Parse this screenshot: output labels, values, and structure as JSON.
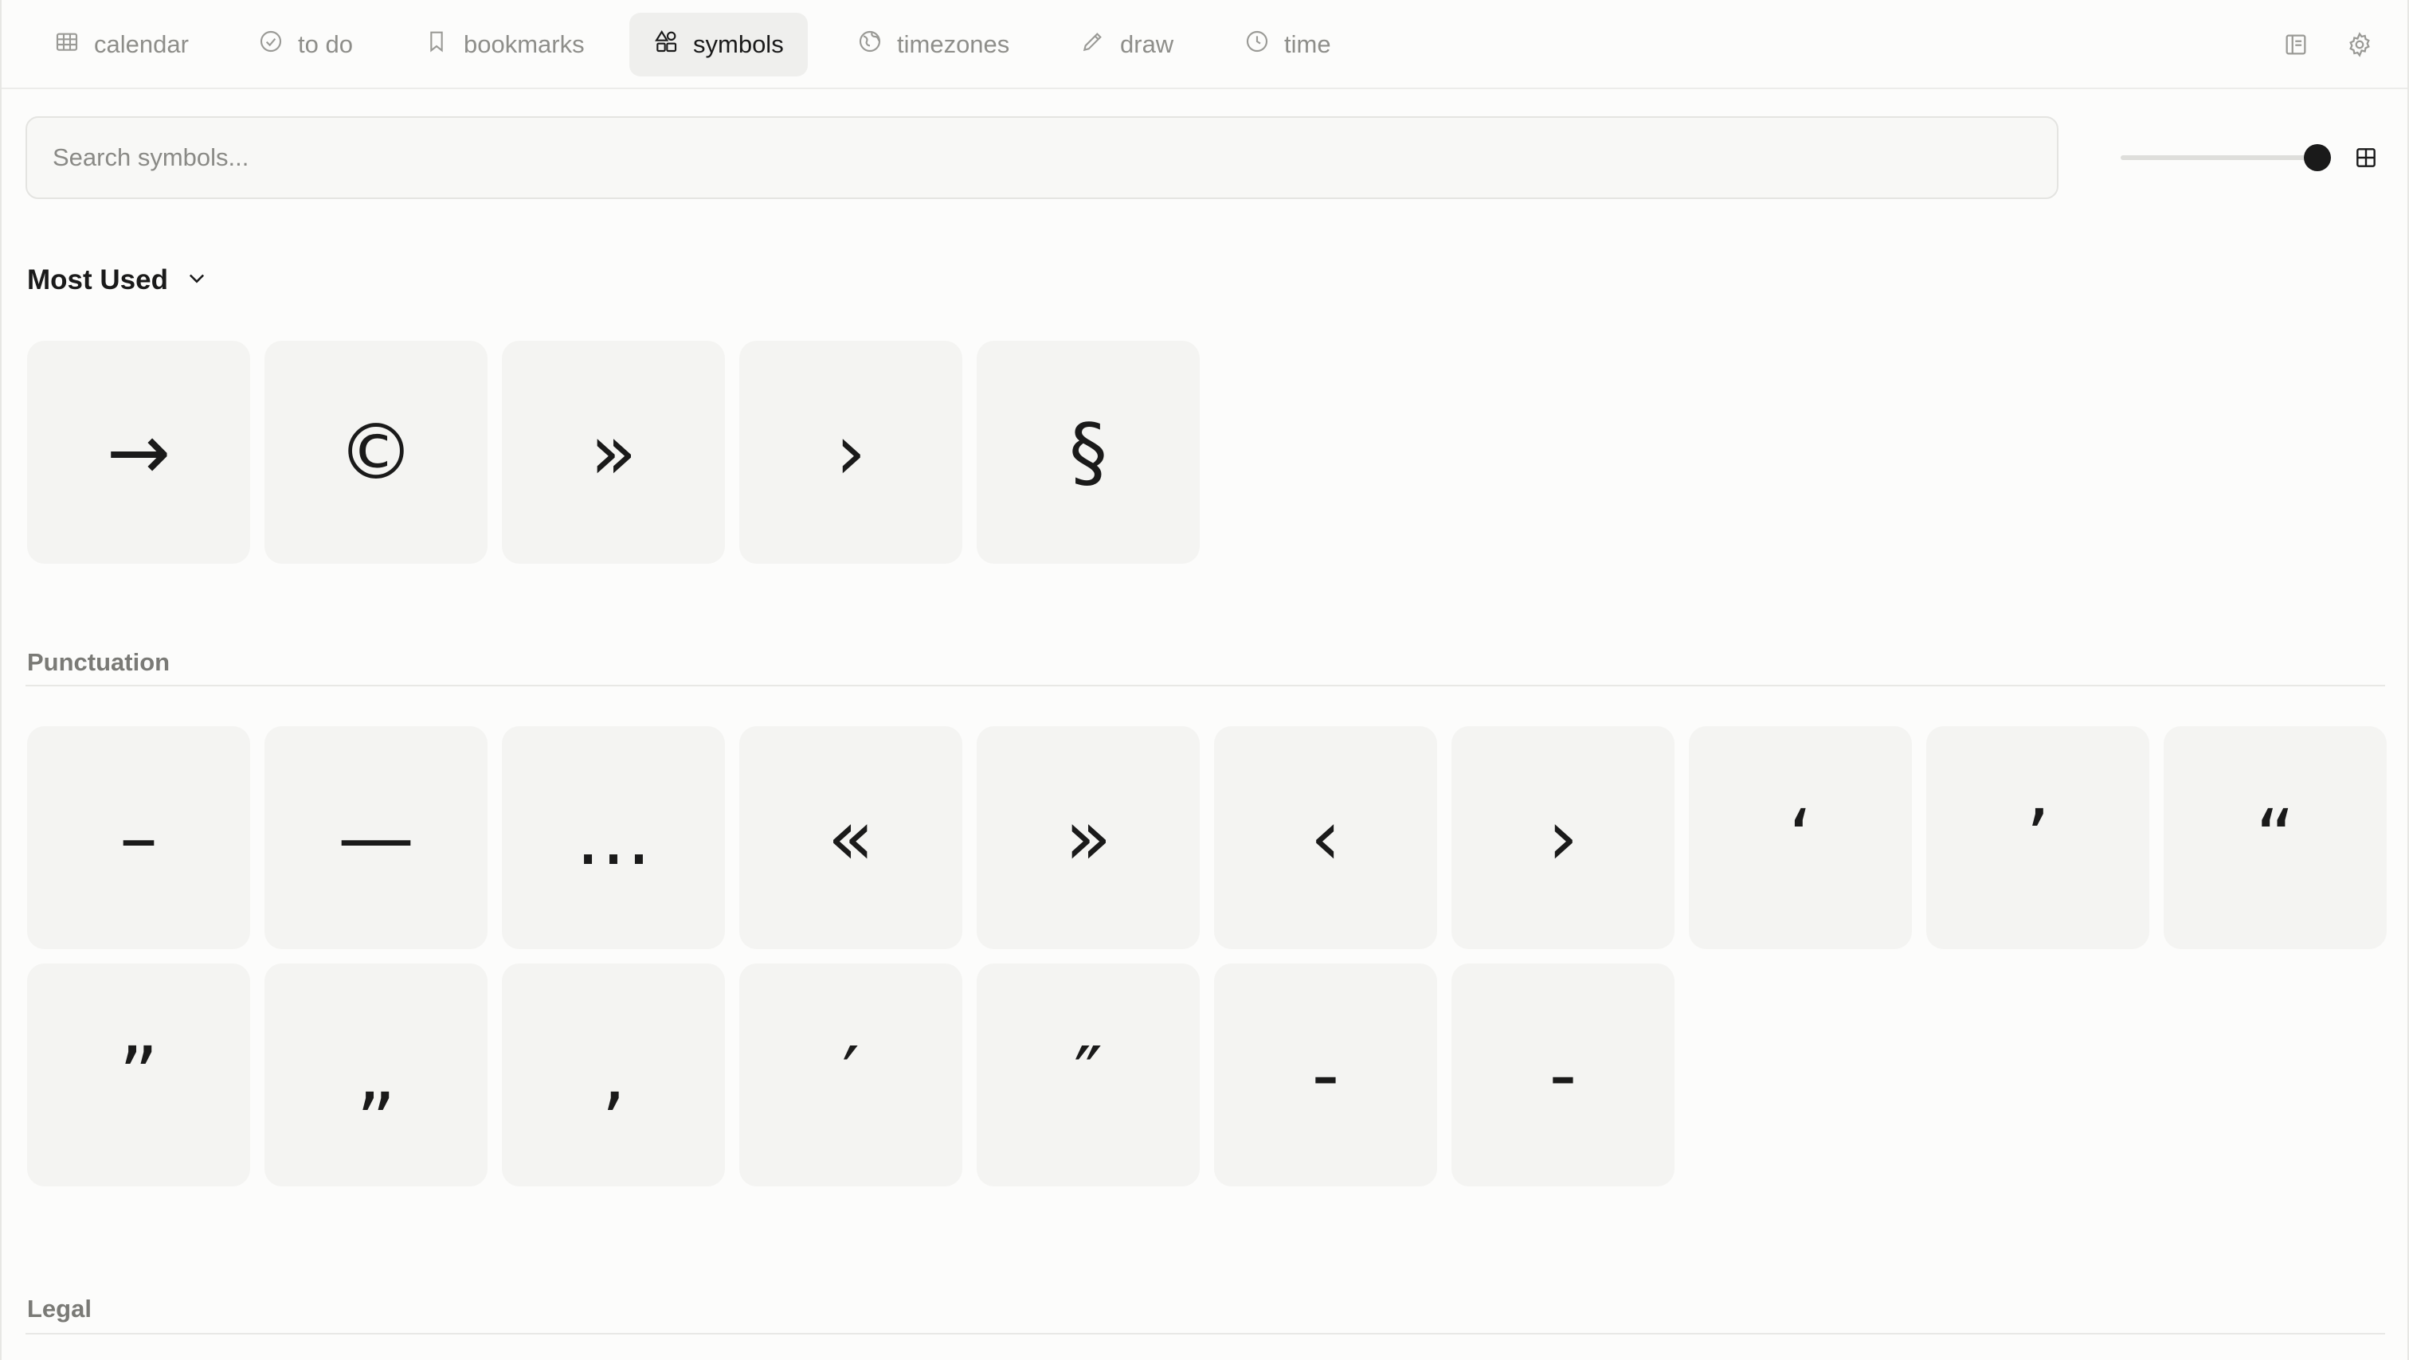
{
  "nav": {
    "tabs": [
      {
        "label": "calendar",
        "icon": "calendar-icon",
        "active": false
      },
      {
        "label": "to do",
        "icon": "check-circle-icon",
        "active": false
      },
      {
        "label": "bookmarks",
        "icon": "bookmark-icon",
        "active": false
      },
      {
        "label": "symbols",
        "icon": "shapes-icon",
        "active": true
      },
      {
        "label": "timezones",
        "icon": "globe-icon",
        "active": false
      },
      {
        "label": "draw",
        "icon": "pencil-icon",
        "active": false
      },
      {
        "label": "time",
        "icon": "clock-icon",
        "active": false
      }
    ],
    "right_icons": [
      "sidebar-panel-icon",
      "settings-gear-icon"
    ]
  },
  "search": {
    "placeholder": "Search symbols...",
    "value": ""
  },
  "size_slider": {
    "level": 1.0
  },
  "grid_toggle_icon": "grid-view-icon",
  "most_used": {
    "title": "Most Used",
    "icon": "chevron-down-icon",
    "symbols": [
      "→",
      "©",
      "»",
      "›",
      "§"
    ]
  },
  "sections": [
    {
      "title": "Punctuation",
      "symbols": [
        "–",
        "—",
        "…",
        "«",
        "»",
        "‹",
        "›",
        "‘",
        "’",
        "“",
        "”",
        "„",
        "‚",
        "′",
        "″",
        "‐",
        "‑"
      ]
    },
    {
      "title": "Legal",
      "symbols": []
    }
  ],
  "colors": {
    "background": "#fcfcfb",
    "tile": "#f4f4f2",
    "active_tab": "#efefed",
    "text": "#1a1a1a",
    "muted": "#8e8e8a"
  }
}
